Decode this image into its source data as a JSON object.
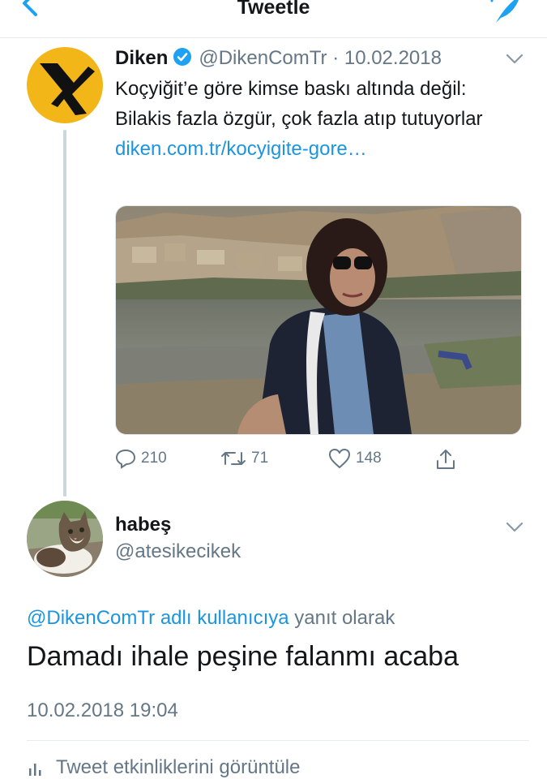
{
  "nav": {
    "title": "Tweetle"
  },
  "original_tweet": {
    "name": "Diken",
    "handle": "@DikenComTr",
    "date": "· 10.02.2018",
    "text": "Koçyiğit’e göre kimse baskı altında değil: Bilakis fazla özgür, çok fazla atıp tutuyorlar",
    "link": "diken.com.tr/kocyigite-gore…",
    "replies": "210",
    "retweets": "71",
    "likes": "148"
  },
  "reply": {
    "name": "habeş",
    "handle": "@atesikecikek",
    "reply_to_handle": "@DikenComTr adlı kullanıcıya",
    "reply_to_suffix": "yanıt olarak",
    "text": "Damadı ihale peşine falanmı acaba",
    "timestamp": "10.02.2018 19:04",
    "activity_label": "Tweet etkinliklerini görüntüle"
  },
  "colors": {
    "accent": "#1b95e0",
    "muted": "#657786",
    "diken_yellow": "#f3b619",
    "verified": "#1da1f2"
  }
}
